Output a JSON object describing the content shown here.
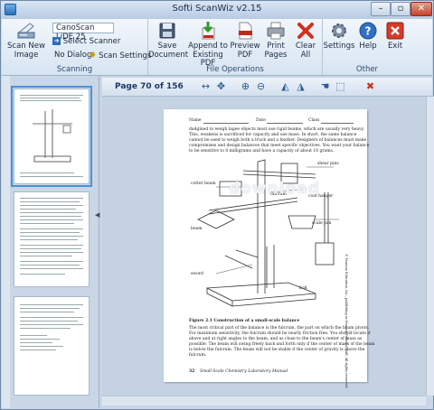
{
  "window": {
    "title": "Softi ScanWiz v2.15",
    "min_label": "–",
    "max_label": "▫",
    "close_label": "✕"
  },
  "ribbon": {
    "scanning": {
      "group_label": "Scanning",
      "scan_new_image": "Scan New Image",
      "scanner_name": "CanoScan LiDE 25",
      "select_scanner": "Select Scanner",
      "no_dialog": "No Dialog",
      "scan_settings": "Scan Settings"
    },
    "file_operations": {
      "group_label": "File Operations",
      "save_document": "Save Document",
      "append_pdf": "Append to Existing PDF",
      "preview_pdf": "Preview PDF",
      "print_pages": "Print Pages",
      "clear_all": "Clear All"
    },
    "other": {
      "group_label": "Other",
      "settings": "Settings",
      "help": "Help",
      "exit": "Exit"
    }
  },
  "viewer": {
    "page_info": "Page 70 of 156",
    "watermark": "download"
  },
  "document": {
    "header_name": "Name",
    "header_date": "Date",
    "header_class": "Class",
    "para1": "dadgined to weigh lagee objects most use rigid beams, which are usually very heavy.",
    "para2": "This, weakens is sacrificed for capacity and use mass. In short, the same balance",
    "para3": "cannot be used to weigh both a truck and a feather. Designers of balances must make",
    "para4": "compromises and design balances that meet specific objectives. You want your balance",
    "para5": "to be sensitive to 0 milligrams and have a capacity of about 10 grams.",
    "figure_caption": "Figure 2.1  Construction of a small-scale balance",
    "body1": "The most critical part of the balance is the fulcrum, the part on which the beam pivots.",
    "body2": "For maximum sensitivity, the fulcrum should be nearly friction free. You should locate it",
    "body3": "above and at right angles to the beam, and as close to the beam's center of mass as",
    "body4": "possible. The beam will swing freely back and forth only if the center of mass of the beam",
    "body5": "is below the fulcrum. The beam will not be stable if the center of gravity is above the",
    "body6": "fulcrum.",
    "footer_page": "32",
    "footer_title": "Small-Scale Chemistry Laboratory Manual",
    "side_note": "© Pearson Education, Inc., publishing as Pearson Prentice Hall. All rights reserved.",
    "labels": [
      "cotter beam",
      "shear pins",
      "coat hanger",
      "fulcrum",
      "beam",
      "scale pan",
      "sword",
      "bolt"
    ]
  },
  "colors": {
    "ribbon_bg": "#e6eef7",
    "accent": "#4a90d9",
    "delete_red": "#d0301c"
  }
}
